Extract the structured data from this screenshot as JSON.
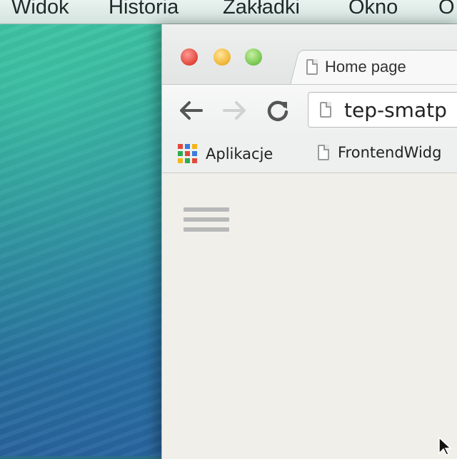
{
  "menubar": {
    "items": [
      "Widok",
      "Historia",
      "Zakładki",
      "Okno",
      "O"
    ]
  },
  "browser": {
    "tab": {
      "title": "Home page",
      "icon": "page-icon"
    },
    "toolbar": {
      "back_icon": "arrow-left-icon",
      "forward_icon": "arrow-right-icon",
      "reload_icon": "reload-icon",
      "url": "tep-smatp"
    },
    "bookmarks": [
      {
        "label": "Aplikacje",
        "icon": "apps-grid-icon"
      },
      {
        "label": "FrontendWidg",
        "icon": "page-icon"
      }
    ],
    "content": {
      "menu_icon": "hamburger-menu-icon"
    }
  },
  "colors": {
    "close": "#e0443a",
    "minimize": "#efb431",
    "maximize": "#74c44b",
    "apps_grid": [
      "#e04a3a",
      "#3b7be0",
      "#f2b51c",
      "#2eaa52",
      "#e04a3a",
      "#3b7be0",
      "#f2b51c",
      "#2eaa52",
      "#e04a3a"
    ]
  }
}
